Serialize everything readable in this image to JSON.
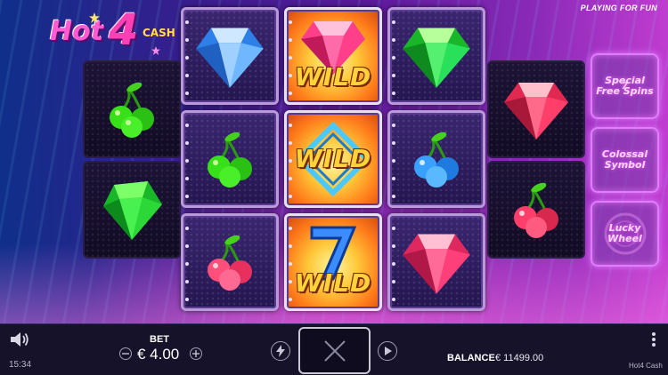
{
  "header": {
    "logo": {
      "hot": "Hot",
      "four": "4",
      "cash": "CASH"
    },
    "mode_label": "PLAYING FOR FUN"
  },
  "reels": [
    [
      {
        "symbol": "cherries",
        "color": "#38e01a"
      },
      {
        "symbol": "gem",
        "color": "#2bd838"
      }
    ],
    [
      {
        "symbol": "gem",
        "color": "#6fb8ff"
      },
      {
        "symbol": "cherries",
        "color": "#38e01a"
      },
      {
        "symbol": "cherries",
        "color": "#ff4f7a"
      }
    ],
    [
      {
        "symbol": "wild-gem",
        "color": "#ff3f8a",
        "label": "WILD"
      },
      {
        "symbol": "wild-diamond",
        "color": "#4bc8ff",
        "label": "WILD"
      },
      {
        "symbol": "wild-seven",
        "color": "#3a8cff",
        "label": "WILD"
      }
    ],
    [
      {
        "symbol": "gem",
        "color": "#28e05a"
      },
      {
        "symbol": "cherries",
        "color": "#3aa0ff"
      },
      {
        "symbol": "gem",
        "color": "#ff3f7a"
      }
    ],
    [
      {
        "symbol": "gem",
        "color": "#ff3f6a"
      },
      {
        "symbol": "cherries",
        "color": "#ff3f6a"
      }
    ]
  ],
  "features": [
    {
      "label": "Special\nFree Spins",
      "icon": "seven-icon"
    },
    {
      "label": "Colossal\nSymbol",
      "icon": "colossal-icon"
    },
    {
      "label": "Lucky\nWheel",
      "icon": "wheel-icon"
    }
  ],
  "hud": {
    "time": "15:34",
    "bet_label": "BET",
    "bet_value": "€ 4.00",
    "balance_label": "BALANCE",
    "balance_value": "€ 11499.00",
    "game_name": "Hot4 Cash",
    "icons": [
      "speaker-icon",
      "minus-icon",
      "plus-icon",
      "turbo-icon",
      "close-icon",
      "autoplay-icon",
      "menu-icon"
    ]
  },
  "colors": {
    "accent": "#e27cff",
    "hud_bg": "#16122a",
    "wild_text": "#ffd23a"
  }
}
